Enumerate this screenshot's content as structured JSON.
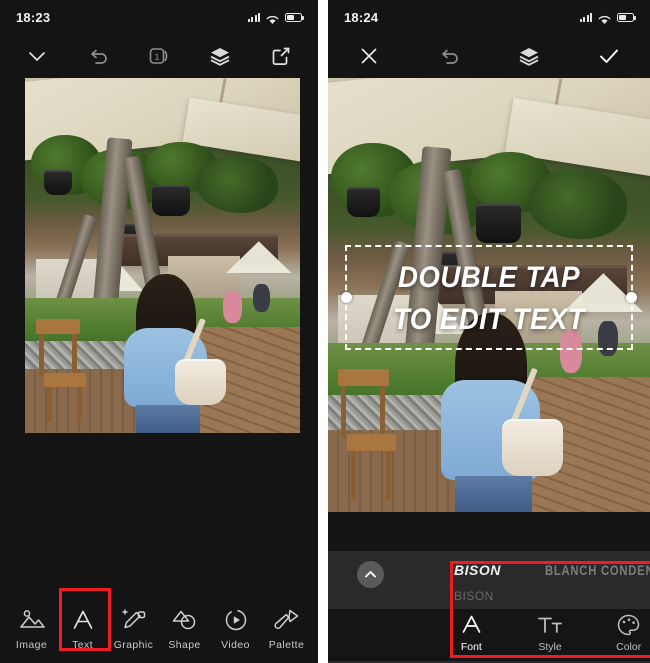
{
  "app": {
    "name": "photo-video-editor",
    "accent_red": "#ee1c25",
    "background": "#141414"
  },
  "left_phone": {
    "status": {
      "time": "18:23",
      "signal_icon": "signal-bars-icon",
      "wifi_icon": "wifi-icon",
      "battery_icon": "battery-half-icon"
    },
    "toolbar": [
      {
        "name": "collapse-down-button",
        "icon": "chevron-down-icon"
      },
      {
        "name": "undo-button",
        "icon": "undo-arrow-icon"
      },
      {
        "name": "pages-button",
        "icon": "page-count-icon",
        "badge": "1"
      },
      {
        "name": "layers-button",
        "icon": "layers-icon"
      },
      {
        "name": "export-button",
        "icon": "share-export-icon"
      }
    ],
    "tools": [
      {
        "label": "Image",
        "icon": "image-icon",
        "selected": false
      },
      {
        "label": "Text",
        "icon": "letter-a-icon",
        "selected": true
      },
      {
        "label": "Graphic",
        "icon": "graphic-pen-icon",
        "selected": false
      },
      {
        "label": "Shape",
        "icon": "shape-icon",
        "selected": false
      },
      {
        "label": "Video",
        "icon": "video-play-icon",
        "selected": false
      },
      {
        "label": "Palette",
        "icon": "palette-brush-icon",
        "selected": false
      }
    ]
  },
  "right_phone": {
    "status": {
      "time": "18:24",
      "signal_icon": "signal-bars-icon",
      "wifi_icon": "wifi-icon",
      "battery_icon": "battery-half-icon"
    },
    "toolbar": [
      {
        "name": "close-button",
        "icon": "close-x-icon"
      },
      {
        "name": "undo-button",
        "icon": "undo-arrow-icon"
      },
      {
        "name": "layers-button",
        "icon": "layers-icon"
      },
      {
        "name": "confirm-button",
        "icon": "checkmark-icon"
      }
    ],
    "canvas_text": {
      "line1": "DOUBLE TAP",
      "line2": "TO EDIT TEXT",
      "selected": true
    },
    "sheet": {
      "collapse_icon": "chevron-up-icon",
      "fonts": [
        {
          "name": "BISON",
          "selected": true
        },
        {
          "name": "BLANCH CONDENSED BY A",
          "selected": false
        }
      ],
      "font_preview_second_row": "BISON",
      "tabs": [
        {
          "label": "Font",
          "icon": "letter-a-icon",
          "selected": true
        },
        {
          "label": "Style",
          "icon": "text-size-icon",
          "selected": false
        },
        {
          "label": "Color",
          "icon": "palette-color-icon",
          "selected": false
        }
      ]
    }
  },
  "annotations": {
    "left_highlight_target": "Text",
    "right_highlight_target": "Font"
  }
}
